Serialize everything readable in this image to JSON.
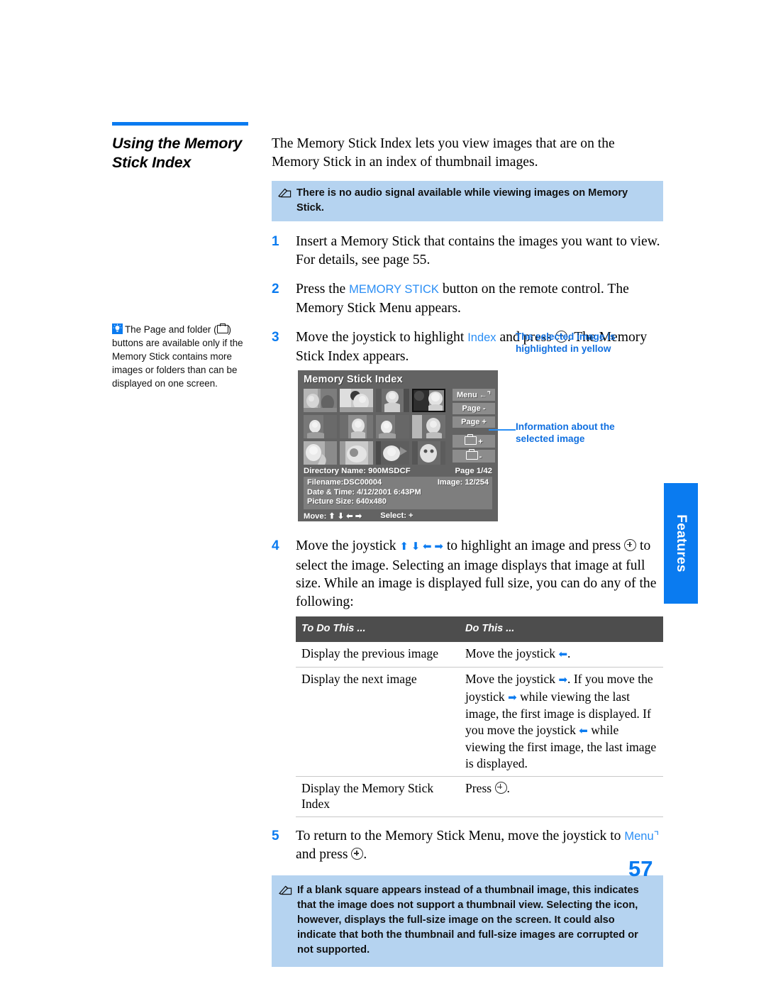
{
  "section": {
    "title": "Using the Memory Stick Index",
    "rule_color": "#0a7bf0"
  },
  "intro": {
    "paragraph": "The Memory Stick Index lets you view images that are on the Memory Stick in an index of thumbnail images."
  },
  "note_top": {
    "icon": "note-pencil-icon",
    "text": "There is no audio signal available while viewing images on Memory Stick."
  },
  "steps": [
    {
      "number": "1",
      "text_before": "Insert a Memory Stick that contains the images you want to view. For details, see page 55.",
      "ui_word": "",
      "text_after": ""
    },
    {
      "number": "2",
      "text_before": "Press the ",
      "ui_word": "MEMORY STICK",
      "text_after": " button on the remote control. The Memory Stick Menu appears."
    },
    {
      "number": "3",
      "text_before": "Move the joystick to highlight ",
      "ui_word": "Index",
      "text_after": " and press ",
      "text_tail": ". The Memory Stick Index appears."
    },
    {
      "number": "4",
      "text_before": "Move the joystick ",
      "arrows": "⬆ ⬇ ⬅ ➡",
      "text_mid": " to highlight an image and press ",
      "text_after": " to select the image. Selecting an image displays that image at full size. While an image is displayed full size, you can do any of the following:"
    },
    {
      "number": "5",
      "text_before": "To return to the Memory Stick Menu, move the joystick to ",
      "ui_word": "Menu",
      "text_after": " and press ",
      "text_tail": "."
    }
  ],
  "sidebar_note": {
    "icon": "tip-lightbulb-icon",
    "text_part1": "The Page and folder (",
    "folder_icon": "folder-icon",
    "text_part2": ") buttons are available only if the Memory Stick contains more images or folders than can be displayed on one screen."
  },
  "tv_screen": {
    "title": "Memory Stick Index",
    "buttons": [
      {
        "name": "menu-button",
        "label": "Menu",
        "glyph": "return-arrow"
      },
      {
        "name": "page-minus-button",
        "label": "Page -",
        "glyph": ""
      },
      {
        "name": "page-plus-button",
        "label": "Page +",
        "glyph": ""
      },
      {
        "name": "folder-plus-button",
        "label": "+",
        "glyph": "folder"
      },
      {
        "name": "folder-minus-button",
        "label": "-",
        "glyph": "folder"
      }
    ],
    "directory_label": "Directory Name: 900MSDCF",
    "page_label": "Page 1/42",
    "info": {
      "filename": "Filename:DSC00004",
      "image_count": "Image: 12/254",
      "datetime": "Date & Time: 4/12/2001 6:43PM",
      "picture_size": "Picture Size: 640x480"
    },
    "footer": {
      "move": "Move: ⬆ ⬇ ⬅ ➡",
      "select": "Select: +"
    },
    "thumbnail_count": 12,
    "selected_thumbnail_index": 3
  },
  "callouts": [
    {
      "name": "callout-selected-image",
      "text": "The selected image is highlighted in yellow"
    },
    {
      "name": "callout-image-info",
      "text": "Information about the selected image"
    }
  ],
  "action_table": {
    "headers": [
      "To Do This ...",
      "Do This ..."
    ],
    "rows": [
      {
        "col1": "Display the previous image",
        "col2_before": "Move the joystick ",
        "col2_arrow1": "⬅",
        "col2_after": "."
      },
      {
        "col1": "Display the next image",
        "col2_before": "Move the joystick ",
        "col2_arrow1": "➡",
        "col2_mid1": ". If you move the joystick ",
        "col2_arrow2": "➡",
        "col2_mid2": " while viewing the last image, the first image is displayed. If you move the joystick ",
        "col2_arrow3": "⬅",
        "col2_after": " while viewing the first image, the last image is displayed."
      },
      {
        "col1": "Display the Memory Stick Index",
        "col2_before": "Press ",
        "col2_after": "."
      }
    ]
  },
  "note_bottom": {
    "icon": "note-pencil-icon",
    "text": "If a blank square appears instead of a thumbnail image, this indicates that the image does not support a thumbnail view. Selecting the icon, however, displays the full-size image on the screen. It could also indicate that both the thumbnail and full-size images are corrupted or not supported."
  },
  "side_tab": {
    "label": "Features",
    "color": "#0a7bf0"
  },
  "page_number": "57"
}
